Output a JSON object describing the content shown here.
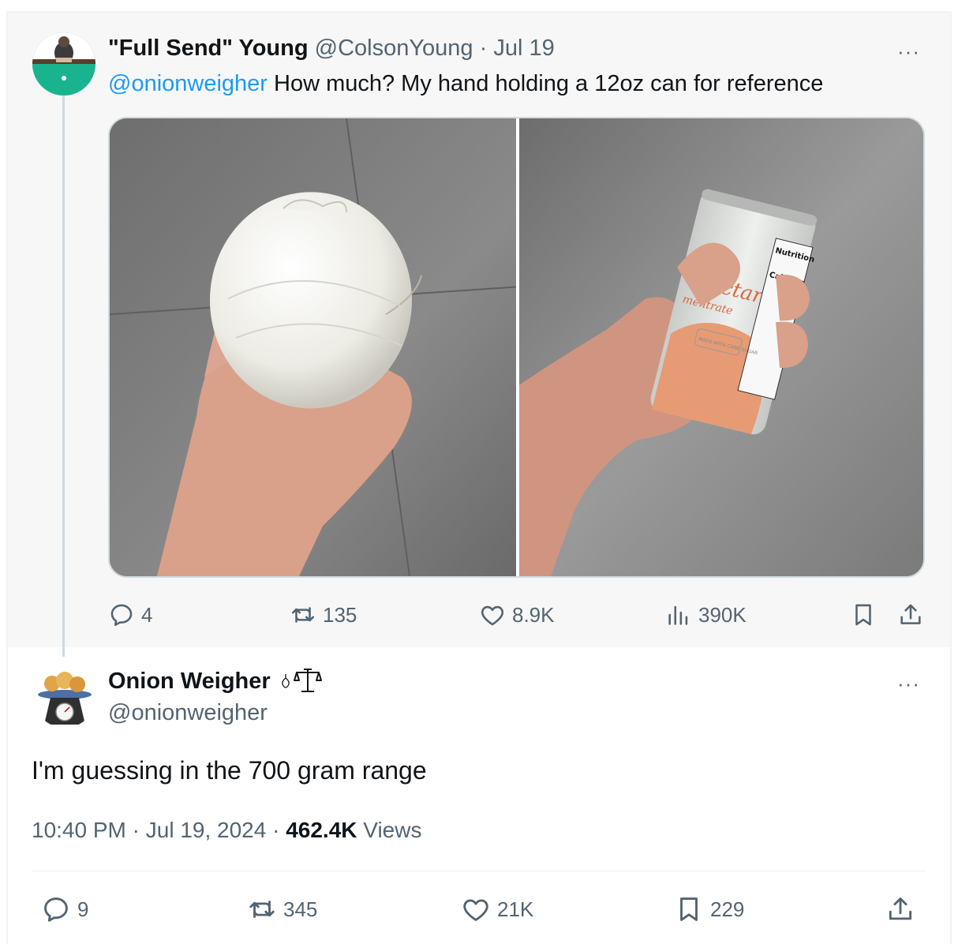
{
  "parent_tweet": {
    "display_name": "\"Full Send\" Young",
    "handle": "@ColsonYoung",
    "separator": "·",
    "date": "Jul 19",
    "more": "···",
    "mention": "@onionweigher",
    "text": " How much? My hand holding a 12oz can for reference",
    "can_label_lines": [
      "Nectar",
      "mentrate"
    ],
    "can_badge": "MADE WITH CANE SUGAR",
    "can_nutrition_title": "Nutrition",
    "can_calories": "Calories",
    "actions": {
      "replies": "4",
      "reposts": "135",
      "likes": "8.9K",
      "views": "390K"
    }
  },
  "reply_tweet": {
    "display_name": "Onion Weigher",
    "handle": "@onionweigher",
    "more": "···",
    "text": "I'm guessing in the 700 gram range",
    "time": "10:40 PM",
    "dot1": " · ",
    "date": "Jul 19, 2024",
    "dot2": " · ",
    "views_count": "462.4K",
    "views_label": " Views",
    "actions": {
      "replies": "9",
      "reposts": "345",
      "likes": "21K",
      "bookmarks": "229"
    }
  },
  "colors": {
    "link": "#1d9bf0",
    "muted": "#536471",
    "text": "#0f1419",
    "parent_bg": "#f7f7f7"
  },
  "icons": [
    "reply-icon",
    "repost-icon",
    "like-icon",
    "views-icon",
    "bookmark-icon",
    "share-icon",
    "more-icon",
    "onion-icon",
    "scale-icon"
  ]
}
